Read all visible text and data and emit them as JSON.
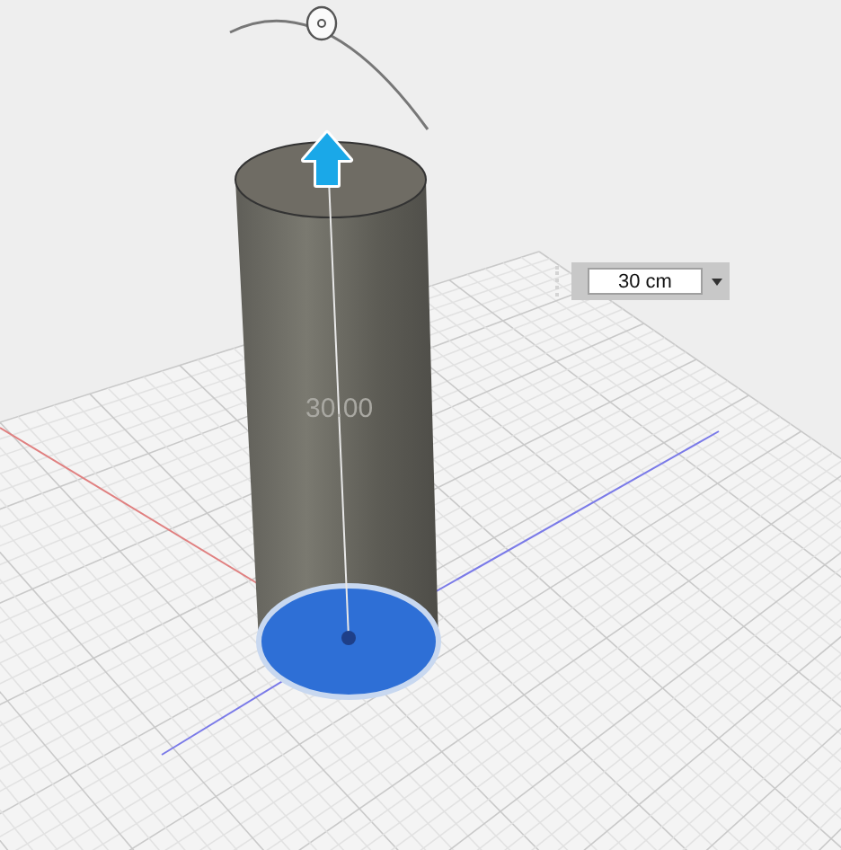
{
  "viewport": {
    "dimension_label": "30.00",
    "distance_input": {
      "value": "30 cm"
    }
  }
}
